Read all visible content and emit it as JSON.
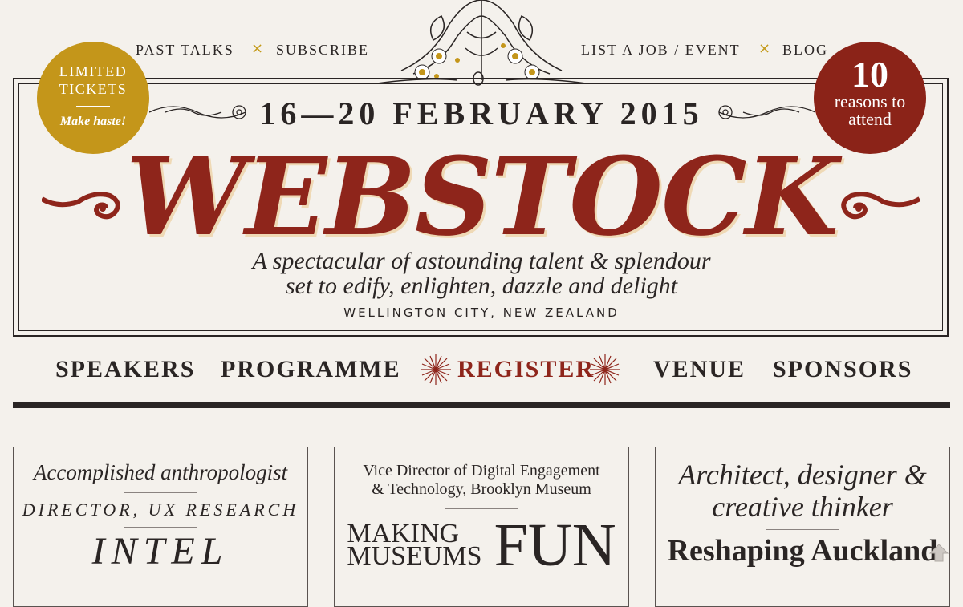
{
  "top_nav": {
    "left": [
      "PAST TALKS",
      "SUBSCRIBE"
    ],
    "right": [
      "LIST A JOB / EVENT",
      "BLOG"
    ],
    "separator": "×"
  },
  "badge_left": {
    "line1": "LIMITED",
    "line2": "TICKETS",
    "line3": "Make haste!"
  },
  "badge_right": {
    "number": "10",
    "line1": "reasons to",
    "line2": "attend"
  },
  "hero": {
    "dates": "16—20 FEBRUARY 2015",
    "title": "WEBSTOCK",
    "tagline1": "A spectacular of astounding talent & splendour",
    "tagline2": "set to edify, enlighten, dazzle and delight",
    "location": "WELLINGTON CITY, NEW ZEALAND"
  },
  "main_nav": {
    "speakers": "SPEAKERS",
    "programme": "PROGRAMME",
    "register": "REGISTER",
    "venue": "VENUE",
    "sponsors": "SPONSORS"
  },
  "cards": [
    {
      "role": "Accomplished anthropologist",
      "title": "DIRECTOR, UX RESEARCH",
      "org": "INTEL"
    },
    {
      "role1": "Vice Director of Digital Engagement",
      "role2": "& Technology, Brooklyn Museum",
      "talk_a1": "MAKING",
      "talk_a2": "MUSEUMS",
      "talk_b": "FUN"
    },
    {
      "role1": "Architect, designer &",
      "role2": "creative thinker",
      "talk": "Reshaping Auckland"
    }
  ],
  "colors": {
    "accent_red": "#8e251b",
    "gold": "#c4961a",
    "ink": "#2a2524",
    "paper": "#f4f1ec"
  }
}
